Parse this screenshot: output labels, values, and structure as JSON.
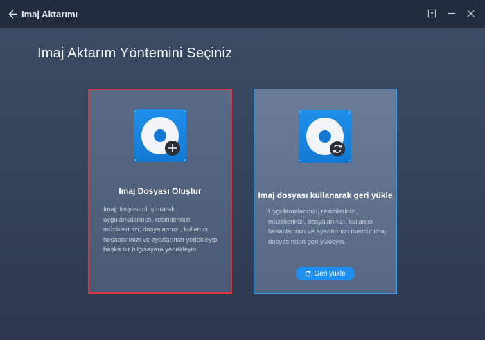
{
  "window": {
    "title": "Imaj Aktarımı",
    "back_icon": "arrow-left-icon",
    "buttons": [
      "restore-window-icon",
      "minimize-icon",
      "close-icon"
    ]
  },
  "page": {
    "title": "Imaj Aktarım Yöntemini Seçiniz"
  },
  "options": [
    {
      "heading": "Imaj Dosyası Oluştur",
      "description": "Imaj dosyası oluşturarak uygulamalarınızı, resimlerinizi, müziklerinizi, dosyalarınızı, kullanıcı hesaplarınızı ve ayarlarınızı yedekleyip başka bir bilgisayara yedekleyin.",
      "icon": "disc-add-icon",
      "selected": true
    },
    {
      "heading": "Imaj dosyası kullanarak geri yükle",
      "description": "Uygulamalarınızı, resimlerinizi, müziklerinizi, dosyalarınızı, kullanıcı hesaplarınızı ve ayarlarınızı mevcut imaj dosyasından geri yükleyin.",
      "icon": "disc-restore-icon",
      "button_label": "Geri yükle",
      "selected": false
    }
  ],
  "colors": {
    "accent": "#1e8ff0",
    "selection_border": "#d8383a",
    "titlebar": "#222c3d"
  }
}
